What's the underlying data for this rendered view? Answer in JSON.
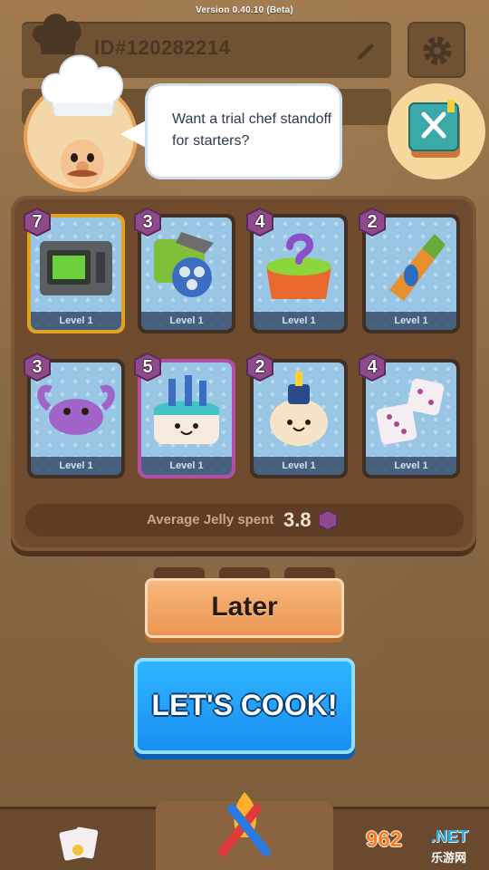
{
  "header": {
    "version": "Version 0.40.10 (Beta)",
    "player_id": "ID#120282214"
  },
  "dialog": {
    "text": "Want a trial chef standoff for starters?"
  },
  "deck": {
    "cards": [
      {
        "cost": "7",
        "level": "Level 1",
        "icon": "microwave-icon",
        "frame": "gold"
      },
      {
        "cost": "3",
        "level": "Level 1",
        "icon": "grinder-icon",
        "frame": "dark"
      },
      {
        "cost": "4",
        "level": "Level 1",
        "icon": "mystery-pot-icon",
        "frame": "dark"
      },
      {
        "cost": "2",
        "level": "Level 1",
        "icon": "pepper-shaker-icon",
        "frame": "dark"
      },
      {
        "cost": "3",
        "level": "Level 1",
        "icon": "crab-icon",
        "frame": "dark"
      },
      {
        "cost": "5",
        "level": "Level 1",
        "icon": "birthday-cake-icon",
        "frame": "purple"
      },
      {
        "cost": "2",
        "level": "Level 1",
        "icon": "garlic-icon",
        "frame": "dark"
      },
      {
        "cost": "4",
        "level": "Level 1",
        "icon": "dice-icon",
        "frame": "dark"
      }
    ],
    "average_label": "Average Jelly spent",
    "average_value": "3.8"
  },
  "buttons": {
    "later": "Later",
    "cook": "LET'S COOK!"
  },
  "watermark": {
    "num": "962",
    "net": ".NET",
    "sub": "乐游网"
  },
  "colors": {
    "cook_blue": "#1a8ef2",
    "later_orange": "#eb9653",
    "jelly_purple": "#8e4a8a"
  }
}
